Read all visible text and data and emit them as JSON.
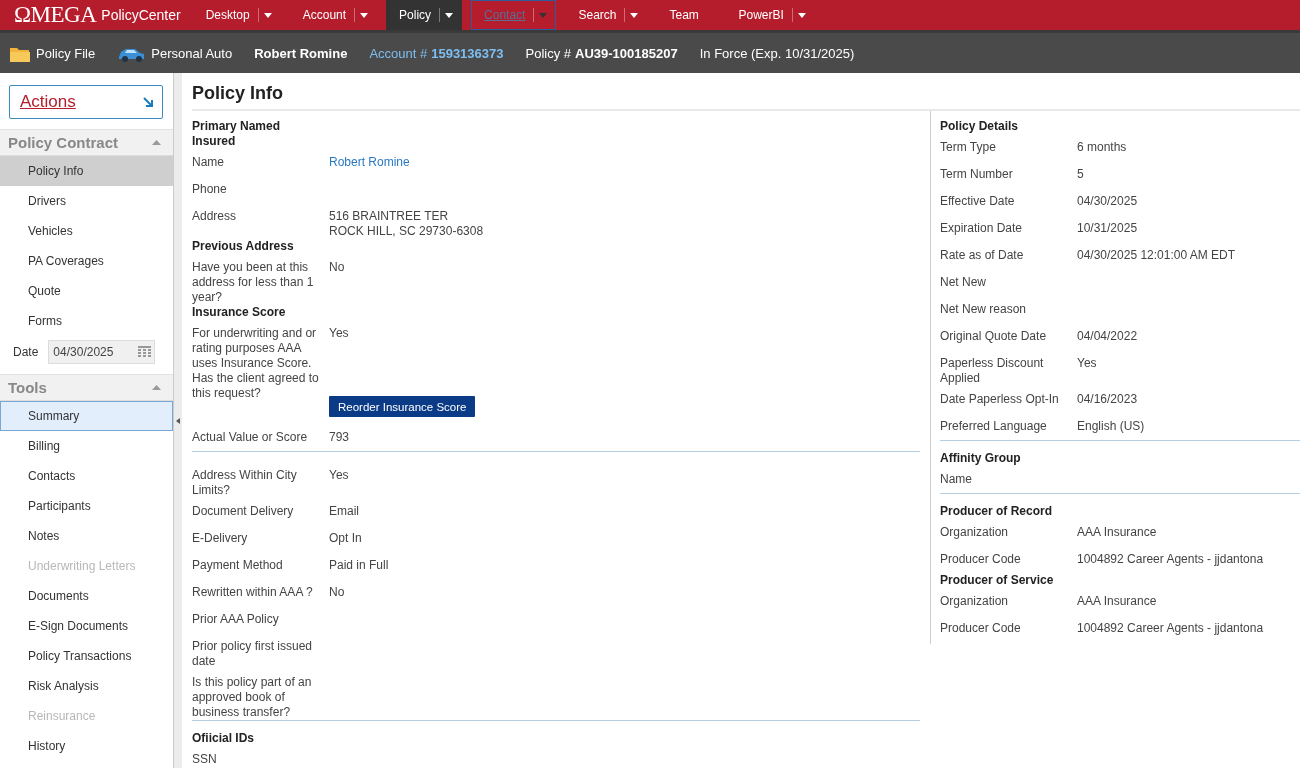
{
  "top_nav": {
    "logo": "ΩMEGA",
    "product": "PolicyCenter",
    "tabs": [
      {
        "label": "Desktop",
        "dropdown": true,
        "selected": false,
        "focused": false
      },
      {
        "label": "Account",
        "dropdown": true,
        "selected": false,
        "focused": false
      },
      {
        "label": "Policy",
        "dropdown": true,
        "selected": true,
        "focused": false
      },
      {
        "label": "Contact",
        "dropdown": true,
        "selected": false,
        "focused": true
      },
      {
        "label": "Search",
        "dropdown": true,
        "selected": false,
        "focused": false
      },
      {
        "label": "Team",
        "dropdown": false,
        "selected": false,
        "focused": false
      },
      {
        "label": "PowerBI",
        "dropdown": true,
        "selected": false,
        "focused": false
      }
    ]
  },
  "info_bar": {
    "items": [
      {
        "kind": "folder",
        "text": "Policy File"
      },
      {
        "kind": "car",
        "text": "Personal Auto"
      },
      {
        "kind": "name",
        "text": "Robert Romine"
      },
      {
        "kind": "link",
        "label": "Account #",
        "value": "1593136373"
      },
      {
        "kind": "labeled",
        "label": "Policy #",
        "value": "AU39-100185207"
      },
      {
        "kind": "plain",
        "text": "In Force (Exp. 10/31/2025)"
      }
    ]
  },
  "sidebar": {
    "actions_button": "Actions",
    "sections": [
      {
        "title": "Policy Contract",
        "expanded": true,
        "items": [
          {
            "label": "Policy Info",
            "selected": true,
            "highlighted": false,
            "disabled": false
          },
          {
            "label": "Drivers",
            "selected": false,
            "highlighted": false,
            "disabled": false
          },
          {
            "label": "Vehicles",
            "selected": false,
            "highlighted": false,
            "disabled": false
          },
          {
            "label": "PA Coverages",
            "selected": false,
            "highlighted": false,
            "disabled": false
          },
          {
            "label": "Quote",
            "selected": false,
            "highlighted": false,
            "disabled": false
          },
          {
            "label": "Forms",
            "selected": false,
            "highlighted": false,
            "disabled": false
          }
        ],
        "date_field": {
          "label": "Date",
          "value": "04/30/2025"
        }
      },
      {
        "title": "Tools",
        "expanded": true,
        "items": [
          {
            "label": "Summary",
            "selected": false,
            "highlighted": true,
            "disabled": false
          },
          {
            "label": "Billing",
            "selected": false,
            "highlighted": false,
            "disabled": false
          },
          {
            "label": "Contacts",
            "selected": false,
            "highlighted": false,
            "disabled": false
          },
          {
            "label": "Participants",
            "selected": false,
            "highlighted": false,
            "disabled": false
          },
          {
            "label": "Notes",
            "selected": false,
            "highlighted": false,
            "disabled": false
          },
          {
            "label": "Underwriting Letters",
            "selected": false,
            "highlighted": false,
            "disabled": true
          },
          {
            "label": "Documents",
            "selected": false,
            "highlighted": false,
            "disabled": false
          },
          {
            "label": "E-Sign Documents",
            "selected": false,
            "highlighted": false,
            "disabled": false
          },
          {
            "label": "Policy Transactions",
            "selected": false,
            "highlighted": false,
            "disabled": false
          },
          {
            "label": "Risk Analysis",
            "selected": false,
            "highlighted": false,
            "disabled": false
          },
          {
            "label": "Reinsurance",
            "selected": false,
            "highlighted": false,
            "disabled": true
          },
          {
            "label": "History",
            "selected": false,
            "highlighted": false,
            "disabled": false
          }
        ]
      }
    ]
  },
  "main": {
    "title": "Policy Info",
    "left_column": [
      {
        "kind": "heading",
        "text": "Primary Named Insured"
      },
      {
        "kind": "link-field",
        "label": "Name",
        "value": "Robert Romine"
      },
      {
        "kind": "field",
        "label": "Phone"
      },
      {
        "kind": "field",
        "label": "Address",
        "value": [
          "516 BRAINTREE TER",
          "ROCK HILL, SC 29730-6308"
        ]
      },
      {
        "kind": "heading",
        "text": "Previous Address"
      },
      {
        "kind": "field",
        "label": "Have you been at this address for less than 1 year?",
        "value": "No"
      },
      {
        "kind": "heading",
        "text": "Insurance Score"
      },
      {
        "kind": "field",
        "label": "For underwriting and or rating purposes AAA uses Insurance Score. Has the client agreed to this request?",
        "value": "Yes"
      },
      {
        "kind": "button",
        "text": "Reorder Insurance Score"
      },
      {
        "kind": "field",
        "label": "Actual Value or Score",
        "value": "793"
      },
      {
        "kind": "divider"
      },
      {
        "kind": "field",
        "label": "Address Within City Limits?",
        "value": "Yes"
      },
      {
        "kind": "field",
        "label": "Document Delivery",
        "value": "Email"
      },
      {
        "kind": "field",
        "label": "E-Delivery",
        "value": "Opt In"
      },
      {
        "kind": "field",
        "label": "Payment Method",
        "value": "Paid in Full"
      },
      {
        "kind": "field",
        "label": "Rewritten within AAA ?",
        "value": "No"
      },
      {
        "kind": "field",
        "label": "Prior AAA Policy"
      },
      {
        "kind": "field",
        "label": "Prior policy first issued date"
      },
      {
        "kind": "field",
        "label": "Is this policy part of an approved book of business transfer?"
      },
      {
        "kind": "divider"
      },
      {
        "kind": "heading",
        "text": "Ofiicial IDs"
      },
      {
        "kind": "field",
        "label": "SSN"
      }
    ],
    "right_column": [
      {
        "kind": "heading",
        "text": "Policy Details"
      },
      {
        "kind": "field",
        "label": "Term Type",
        "value": "6 months"
      },
      {
        "kind": "field",
        "label": "Term Number",
        "value": "5"
      },
      {
        "kind": "field",
        "label": "Effective Date",
        "value": "04/30/2025"
      },
      {
        "kind": "field",
        "label": "Expiration Date",
        "value": "10/31/2025"
      },
      {
        "kind": "field",
        "label": "Rate as of Date",
        "value": "04/30/2025 12:01:00 AM EDT"
      },
      {
        "kind": "field",
        "label": "Net New"
      },
      {
        "kind": "field",
        "label": "Net New reason"
      },
      {
        "kind": "field",
        "label": "Original Quote Date",
        "value": "04/04/2022"
      },
      {
        "kind": "field",
        "label": "Paperless Discount Applied",
        "value": "Yes"
      },
      {
        "kind": "field",
        "label": "Date Paperless Opt-In",
        "value": "04/16/2023"
      },
      {
        "kind": "field",
        "label": "Preferred Language",
        "value": "English (US)"
      },
      {
        "kind": "divider"
      },
      {
        "kind": "heading",
        "text": "Affinity Group"
      },
      {
        "kind": "field",
        "label": "Name"
      },
      {
        "kind": "divider"
      },
      {
        "kind": "heading",
        "text": "Producer of Record"
      },
      {
        "kind": "field",
        "label": "Organization",
        "value": "AAA Insurance"
      },
      {
        "kind": "field",
        "label": "Producer Code",
        "value": "1004892 Career Agents - jjdantona"
      },
      {
        "kind": "heading",
        "text": "Producer of Service"
      },
      {
        "kind": "field",
        "label": "Organization",
        "value": "AAA Insurance"
      },
      {
        "kind": "field",
        "label": "Producer Code",
        "value": "1004892 Career Agents - jjdantona"
      }
    ]
  }
}
